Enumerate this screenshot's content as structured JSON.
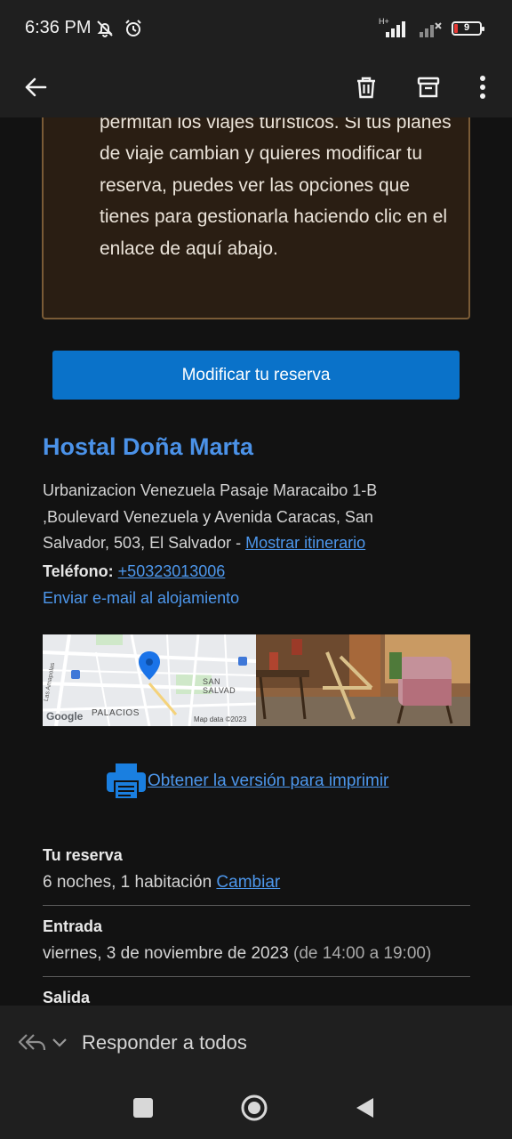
{
  "status_bar": {
    "time": "6:36 PM",
    "network_label": "H+",
    "battery_level": "9",
    "battery_color": "#e53935"
  },
  "toolbar": {
    "back_icon": "arrow-left-icon",
    "delete_icon": "trash-icon",
    "archive_icon": "archive-icon",
    "more_icon": "more-vert-icon"
  },
  "notice": {
    "text": "permitan los viajes turísticos. Si tus planes de viaje cambian y quieres modificar tu reserva, puedes ver las opciones que tienes para gestionarla haciendo clic en el enlace de aquí abajo."
  },
  "modify_button": {
    "label": "Modificar tu reserva",
    "color": "#0a72c9"
  },
  "hotel": {
    "name": "Hostal Doña Marta",
    "address": "Urbanizacion Venezuela Pasaje Maracaibo 1-B ,Boulevard Venezuela y Avenida Caracas, San Salvador, 503, El Salvador - ",
    "itinerary_link": "Mostrar itinerario",
    "phone_label": "Teléfono:",
    "phone_number": "+50323013006",
    "email_link": "Enviar e-mail al alojamiento"
  },
  "map": {
    "label_city": "SAN SALVAD",
    "label_district": "PALACIOS",
    "label_street": "Las Amapolas",
    "google_logo": "Google",
    "attribution": "Map data ©2023"
  },
  "print": {
    "icon": "printer-icon",
    "link": "Obtener la versión para imprimir"
  },
  "reservation": {
    "label": "Tu reserva",
    "value": "6 noches, 1 habitación",
    "change_link": "Cambiar"
  },
  "checkin": {
    "label": "Entrada",
    "date": "viernes, 3 de noviembre de 2023",
    "hours": "(de 14:00 a 19:00)"
  },
  "checkout": {
    "label": "Salida"
  },
  "reply_bar": {
    "label": "Responder a todos"
  }
}
